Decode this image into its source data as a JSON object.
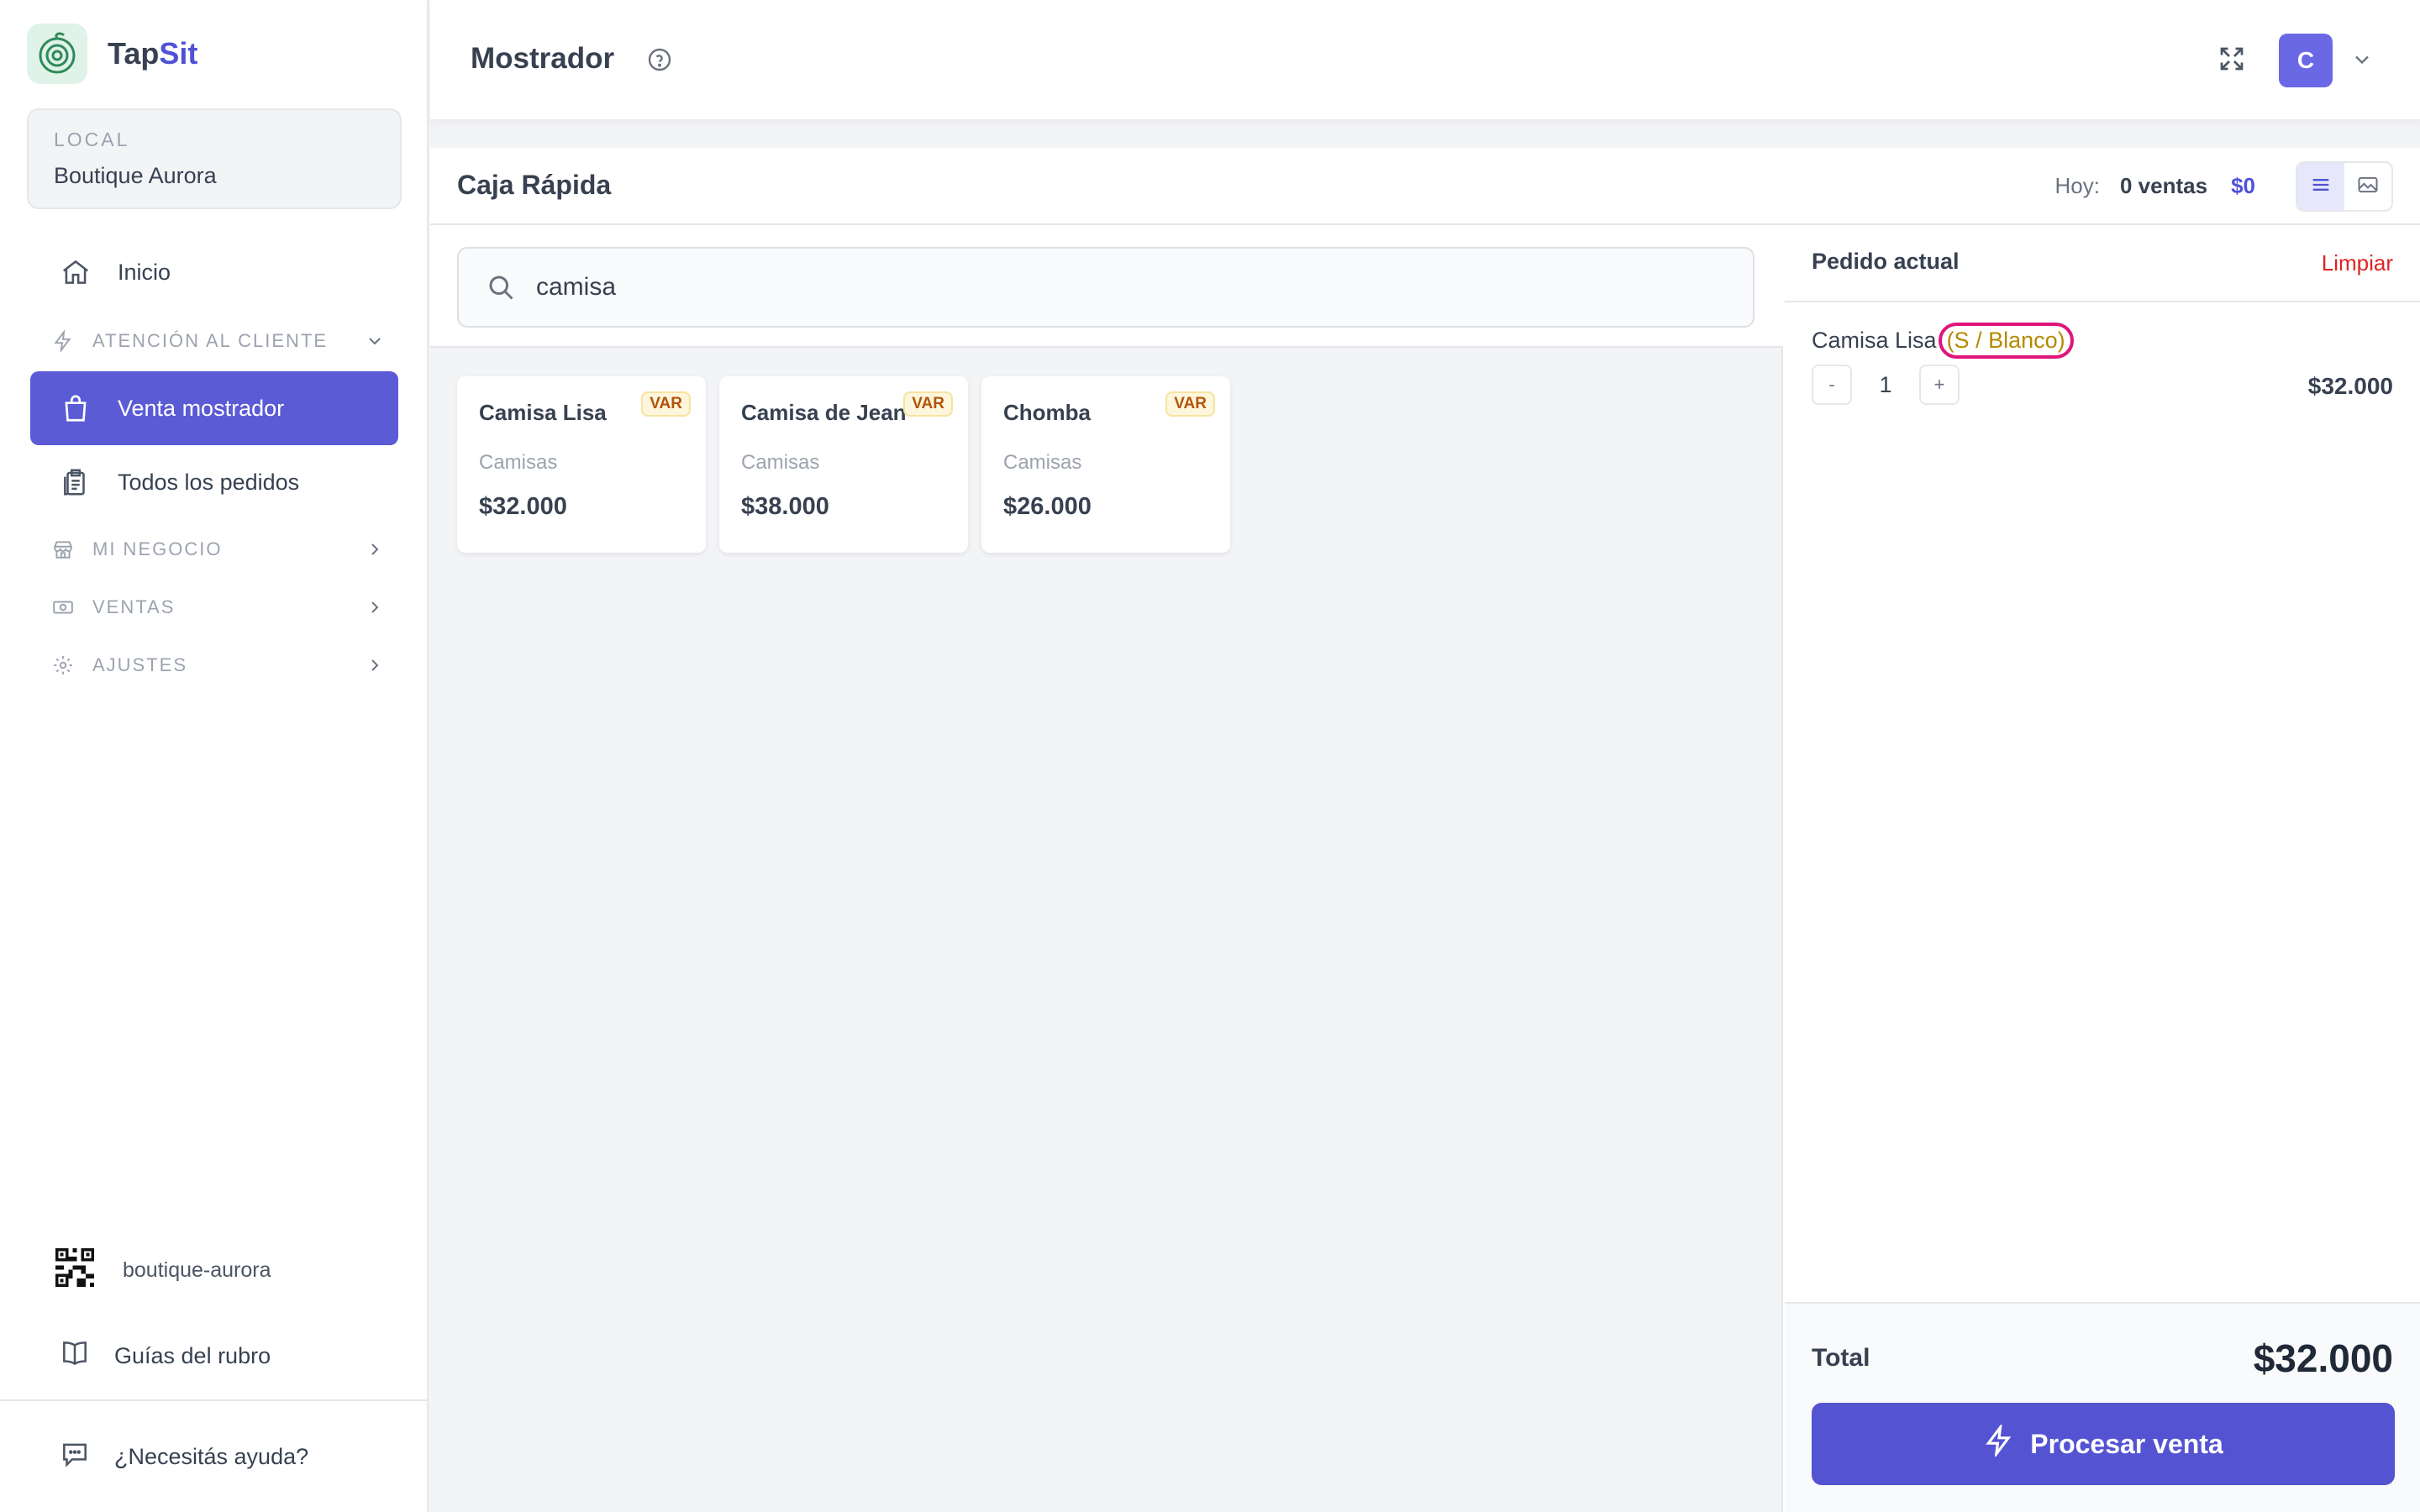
{
  "brand": {
    "name_part1": "Tap",
    "name_part2": "Sit",
    "accent": "#4f52d8"
  },
  "local": {
    "label": "LOCAL",
    "name": "Boutique Aurora"
  },
  "sidebar": {
    "home": {
      "label": "Inicio",
      "icon": "home-icon"
    },
    "section_customer": {
      "label": "ATENCIÓN AL CLIENTE",
      "icon": "bolt-icon"
    },
    "items": [
      {
        "label": "Venta mostrador",
        "icon": "shopping-bag-icon",
        "active": true
      },
      {
        "label": "Todos los pedidos",
        "icon": "clipboard-icon",
        "active": false
      }
    ],
    "sections": [
      {
        "label": "MI NEGOCIO",
        "icon": "store-icon"
      },
      {
        "label": "VENTAS",
        "icon": "cash-icon"
      },
      {
        "label": "AJUSTES",
        "icon": "gear-icon"
      }
    ],
    "qr_slug": "boutique-aurora",
    "guides": "Guías del rubro",
    "help": "¿Necesitás ayuda?"
  },
  "topbar": {
    "title": "Mostrador",
    "user_initial": "C",
    "avatar_color": "#6b68e6"
  },
  "panel": {
    "title": "Caja Rápida",
    "stats_label": "Hoy:",
    "sales_count": "0 ventas",
    "sales_amount": "$0"
  },
  "search": {
    "value": "camisa",
    "placeholder": ""
  },
  "products": [
    {
      "name": "Camisa Lisa",
      "badge": "VAR",
      "category": "Camisas",
      "price": "$32.000"
    },
    {
      "name": "Camisa de Jean",
      "badge": "VAR",
      "category": "Camisas",
      "price": "$38.000"
    },
    {
      "name": "Chomba",
      "badge": "VAR",
      "category": "Camisas",
      "price": "$26.000"
    }
  ],
  "order": {
    "title": "Pedido actual",
    "clear": "Limpiar",
    "items": [
      {
        "name": "Camisa Lisa",
        "variant": "(S / Blanco)",
        "qty_minus": "-",
        "qty": "1",
        "qty_plus": "+",
        "price": "$32.000"
      }
    ],
    "total_label": "Total",
    "total_value": "$32.000",
    "process_label": "Procesar venta",
    "button_color": "#5453d1",
    "clear_color": "#e02424"
  }
}
